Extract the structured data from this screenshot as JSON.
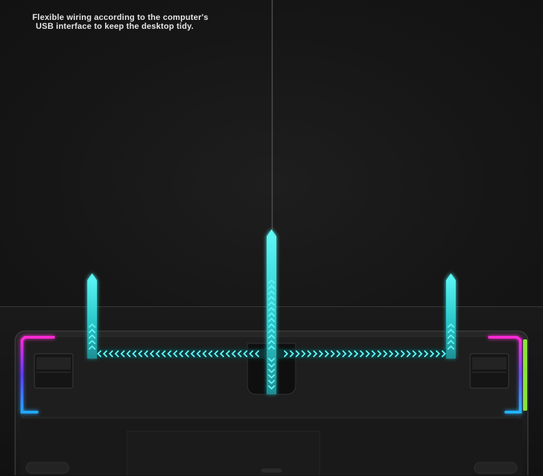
{
  "caption": {
    "line1": "Flexible wiring according to the computer's",
    "line2": "USB interface to keep the desktop tidy."
  },
  "colors": {
    "background": "#141414",
    "cable_glow": "#3ff0f0",
    "chevron": "#5ef3f3",
    "rgb_magenta": "#ff2ad4",
    "rgb_blue": "#2f6bff",
    "rgb_green": "#8be33a",
    "keyboard_body": "#1c1c1c"
  },
  "icons": [
    "arrow-up-icon",
    "chevron-left-icon",
    "chevron-right-icon",
    "chevron-down-icon"
  ]
}
